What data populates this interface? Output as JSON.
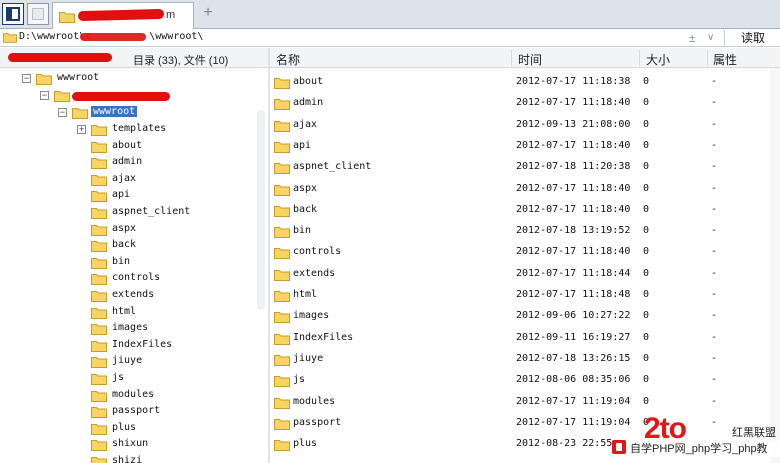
{
  "colors": {
    "folder_body": "#f8d462",
    "folder_edge": "#c99a2e",
    "selection": "#3a72c4",
    "redaction": "#e01010",
    "watermark": "#e01818"
  },
  "tab": {
    "title": "m",
    "add_label": "+"
  },
  "address": {
    "path": "D:\\wwwroot\\c",
    "path_tail": "\\wwwroot\\",
    "plus_label": "±",
    "dropdown_label": "∨",
    "read_label": "读取"
  },
  "tree": {
    "summary": "目录 (33), 文件 (10)",
    "root_label": "wwwroot",
    "selected_label": "wwwroot",
    "items": [
      {
        "label": "templates",
        "expander": "+"
      },
      {
        "label": "about"
      },
      {
        "label": "admin"
      },
      {
        "label": "ajax"
      },
      {
        "label": "api"
      },
      {
        "label": "aspnet_client"
      },
      {
        "label": "aspx"
      },
      {
        "label": "back"
      },
      {
        "label": "bin"
      },
      {
        "label": "controls"
      },
      {
        "label": "extends"
      },
      {
        "label": "html"
      },
      {
        "label": "images"
      },
      {
        "label": "IndexFiles"
      },
      {
        "label": "jiuye"
      },
      {
        "label": "js"
      },
      {
        "label": "modules"
      },
      {
        "label": "passport"
      },
      {
        "label": "plus"
      },
      {
        "label": "shixun"
      },
      {
        "label": "shizi"
      }
    ]
  },
  "list": {
    "columns": {
      "name": "名称",
      "time": "时间",
      "size": "大小",
      "attr": "属性"
    },
    "rows": [
      {
        "name": "about",
        "time": "2012-07-17 11:18:38",
        "size": "0",
        "attr": "-"
      },
      {
        "name": "admin",
        "time": "2012-07-17 11:18:40",
        "size": "0",
        "attr": "-"
      },
      {
        "name": "ajax",
        "time": "2012-09-13 21:08:00",
        "size": "0",
        "attr": "-"
      },
      {
        "name": "api",
        "time": "2012-07-17 11:18:40",
        "size": "0",
        "attr": "-"
      },
      {
        "name": "aspnet_client",
        "time": "2012-07-18 11:20:38",
        "size": "0",
        "attr": "-"
      },
      {
        "name": "aspx",
        "time": "2012-07-17 11:18:40",
        "size": "0",
        "attr": "-"
      },
      {
        "name": "back",
        "time": "2012-07-17 11:18:40",
        "size": "0",
        "attr": "-"
      },
      {
        "name": "bin",
        "time": "2012-07-18 13:19:52",
        "size": "0",
        "attr": "-"
      },
      {
        "name": "controls",
        "time": "2012-07-17 11:18:40",
        "size": "0",
        "attr": "-"
      },
      {
        "name": "extends",
        "time": "2012-07-17 11:18:44",
        "size": "0",
        "attr": "-"
      },
      {
        "name": "html",
        "time": "2012-07-17 11:18:48",
        "size": "0",
        "attr": "-"
      },
      {
        "name": "images",
        "time": "2012-09-06 10:27:22",
        "size": "0",
        "attr": "-"
      },
      {
        "name": "IndexFiles",
        "time": "2012-09-11 16:19:27",
        "size": "0",
        "attr": "-"
      },
      {
        "name": "jiuye",
        "time": "2012-07-18 13:26:15",
        "size": "0",
        "attr": "-"
      },
      {
        "name": "js",
        "time": "2012-08-06 08:35:06",
        "size": "0",
        "attr": "-"
      },
      {
        "name": "modules",
        "time": "2012-07-17 11:19:04",
        "size": "0",
        "attr": "-"
      },
      {
        "name": "passport",
        "time": "2012-07-17 11:19:04",
        "size": "0",
        "attr": "-"
      },
      {
        "name": "plus",
        "time": "2012-08-23 22:55",
        "size": "",
        "attr": ""
      }
    ]
  },
  "watermark": {
    "brand": "2to",
    "side_text": "红黑联盟",
    "strip_text": "自学PHP网_php学习_php教"
  }
}
